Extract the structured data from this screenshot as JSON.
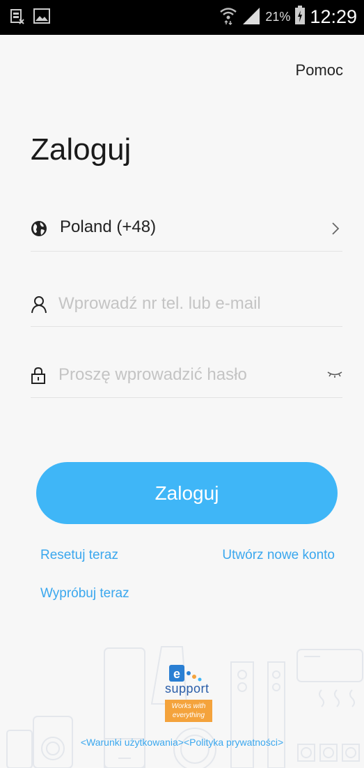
{
  "status_bar": {
    "battery": "21%",
    "time": "12:29"
  },
  "header": {
    "help": "Pomoc"
  },
  "title": "Zaloguj",
  "country": {
    "label": "Poland (+48)"
  },
  "account": {
    "placeholder": "Wprowadź nr tel. lub e-mail",
    "value": ""
  },
  "password": {
    "placeholder": "Proszę wprowadzić hasło",
    "value": ""
  },
  "login_button": "Zaloguj",
  "links": {
    "reset": "Resetuj teraz",
    "create": "Utwórz nowe konto",
    "try": "Wypróbuj teraz"
  },
  "logo": {
    "mark": "e",
    "name": "support",
    "tagline": "Works with everything"
  },
  "legal": {
    "terms": "<Warunki użytkowania>",
    "privacy": "<Polityka prywatności>"
  },
  "colors": {
    "accent": "#3fb6f7",
    "link": "#3aa7ee",
    "logo_tag": "#f4a33c"
  }
}
